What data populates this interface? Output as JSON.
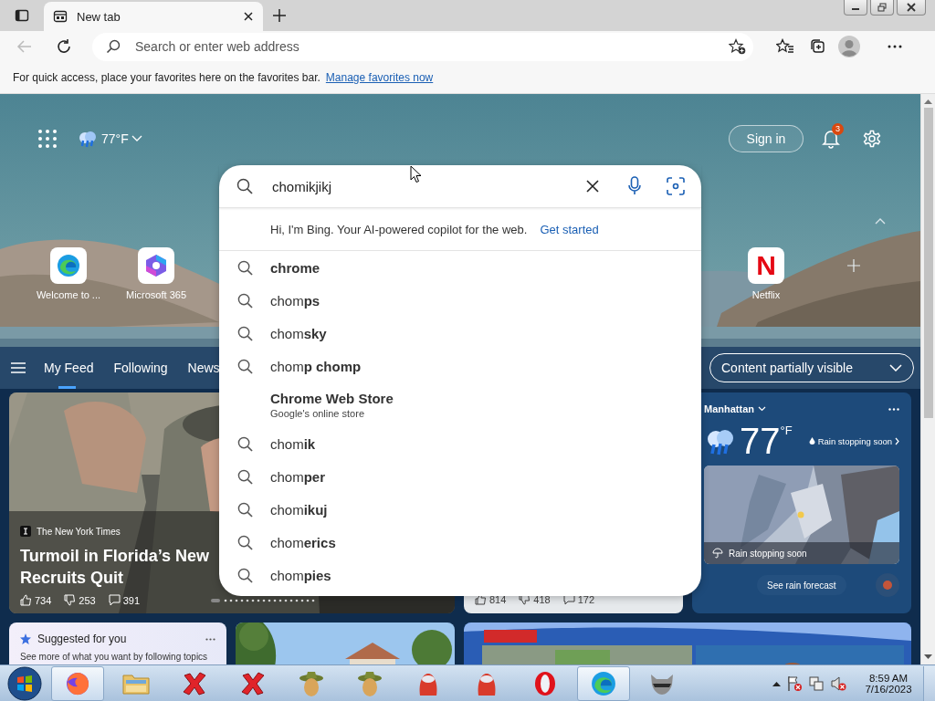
{
  "tabs": [
    {
      "title": "New tab",
      "selected": true
    }
  ],
  "address_bar": {
    "placeholder": "Search or enter web address"
  },
  "favorites_bar": {
    "message": "For quick access, place your favorites here on the favorites bar.",
    "link": "Manage favorites now"
  },
  "header": {
    "weather": "77°F",
    "sign_in": "Sign in",
    "notifications": "3"
  },
  "quick_links": [
    {
      "kind": "edge",
      "label": "Welcome to ..."
    },
    {
      "kind": "m365",
      "label": "Microsoft 365"
    },
    {
      "kind": "letter",
      "glyph": "N",
      "label": "Netflix"
    }
  ],
  "feed_nav": {
    "tabs": [
      {
        "label": "My Feed",
        "selected": true
      },
      {
        "label": "Following",
        "selected": false
      },
      {
        "label": "News",
        "selected": false
      }
    ],
    "visibility": "Content partially visible"
  },
  "headline_card": {
    "source": "The New York Times",
    "headline_lines": [
      "Turmoil in Florida’s New",
      "Recruits Quit"
    ],
    "likes": "734",
    "dislikes": "253",
    "comments": "391"
  },
  "second_card": {
    "likes": "814",
    "dislikes": "418",
    "comments": "172"
  },
  "weather_card": {
    "location": "Manhattan",
    "temperature": "77",
    "unit": "°F",
    "alert": "Rain stopping soon",
    "map_caption": "Rain stopping soon",
    "forecast_button": "See rain forecast"
  },
  "suggested_card": {
    "title": "Suggested for you",
    "text": "See more of what you want by following topics"
  },
  "search_panel": {
    "value": "chomikjikj",
    "bing_message": "Hi, I'm Bing. Your AI-powered copilot for the web.",
    "bing_link": "Get started",
    "suggestions": [
      {
        "kind": "query",
        "completion": "chrome"
      },
      {
        "kind": "query",
        "prefix": "chom",
        "completion": "ps"
      },
      {
        "kind": "query",
        "prefix": "chom",
        "completion": "sky"
      },
      {
        "kind": "query",
        "prefix": "chom",
        "completion": "p chomp"
      },
      {
        "kind": "site",
        "title": "Chrome Web Store",
        "subtitle": "Google's online store"
      },
      {
        "kind": "query",
        "prefix": "chom",
        "completion": "ik"
      },
      {
        "kind": "query",
        "prefix": "chom",
        "completion": "per"
      },
      {
        "kind": "query",
        "prefix": "chom",
        "completion": "ikuj"
      },
      {
        "kind": "query",
        "prefix": "chom",
        "completion": "erics"
      },
      {
        "kind": "query",
        "prefix": "chom",
        "completion": "pies"
      }
    ]
  },
  "taskbar": {
    "apps": [
      {
        "kind": "firefox",
        "active": true
      },
      {
        "kind": "folder",
        "active": false
      },
      {
        "kind": "cross",
        "active": false
      },
      {
        "kind": "cross",
        "active": false
      },
      {
        "kind": "hat",
        "active": false
      },
      {
        "kind": "hat",
        "active": false
      },
      {
        "kind": "ball",
        "active": false
      },
      {
        "kind": "ball",
        "active": false
      },
      {
        "kind": "opera",
        "active": false
      },
      {
        "kind": "edge",
        "active": true
      },
      {
        "kind": "raccoon",
        "active": false
      }
    ],
    "time": "8:59 AM",
    "date": "7/16/2023"
  }
}
